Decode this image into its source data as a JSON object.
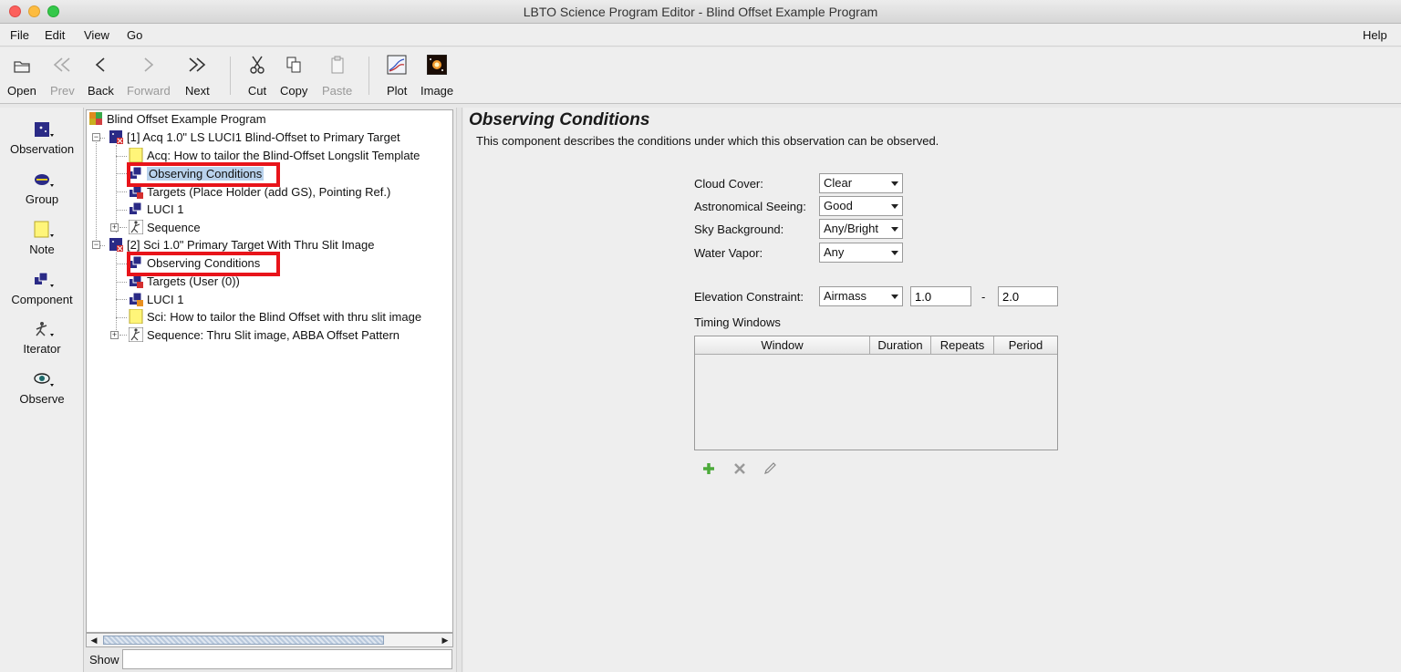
{
  "window": {
    "title": "LBTO Science Program Editor - Blind Offset Example Program"
  },
  "menu": {
    "file": "File",
    "edit": "Edit",
    "view": "View",
    "go": "Go",
    "help": "Help"
  },
  "toolbar": {
    "open": "Open",
    "prev": "Prev",
    "back": "Back",
    "forward": "Forward",
    "next": "Next",
    "cut": "Cut",
    "copy": "Copy",
    "paste": "Paste",
    "plot": "Plot",
    "image": "Image"
  },
  "palette": {
    "observation": "Observation",
    "group": "Group",
    "note": "Note",
    "component": "Component",
    "iterator": "Iterator",
    "observe": "Observe"
  },
  "tree": {
    "root": "Blind Offset Example Program",
    "obs1": "[1] Acq 1.0\" LS LUCI1 Blind-Offset to Primary Target",
    "obs1_note": "Acq: How to tailor the Blind-Offset Longslit Template",
    "obs1_conditions": "Observing Conditions",
    "obs1_targets": "Targets (Place Holder (add GS), Pointing Ref.)",
    "obs1_luci": "LUCI 1",
    "obs1_sequence": "Sequence",
    "obs2": "[2] Sci 1.0\" Primary Target With Thru Slit Image",
    "obs2_conditions": "Observing Conditions",
    "obs2_targets": "Targets (User (0))",
    "obs2_luci": "LUCI 1",
    "obs2_note": "Sci: How to tailor the Blind Offset with thru slit image",
    "obs2_sequence": "Sequence: Thru Slit image, ABBA Offset Pattern"
  },
  "show": {
    "label": "Show",
    "value": ""
  },
  "panel": {
    "title": "Observing Conditions",
    "description": "This component describes the conditions under which this observation can be observed.",
    "cloud_cover_label": "Cloud Cover:",
    "cloud_cover_value": "Clear",
    "seeing_label": "Astronomical Seeing:",
    "seeing_value": "Good",
    "sky_label": "Sky Background:",
    "sky_value": "Any/Bright",
    "water_label": "Water Vapor:",
    "water_value": "Any",
    "elevation_label": "Elevation Constraint:",
    "elevation_type": "Airmass",
    "elevation_min": "1.0",
    "elevation_dash": "-",
    "elevation_max": "2.0",
    "timing_label": "Timing Windows",
    "timing_columns": [
      "Window",
      "Duration",
      "Repeats",
      "Period"
    ]
  },
  "colors": {
    "highlight": "#e8141a",
    "selection": "#b9d2ec"
  }
}
